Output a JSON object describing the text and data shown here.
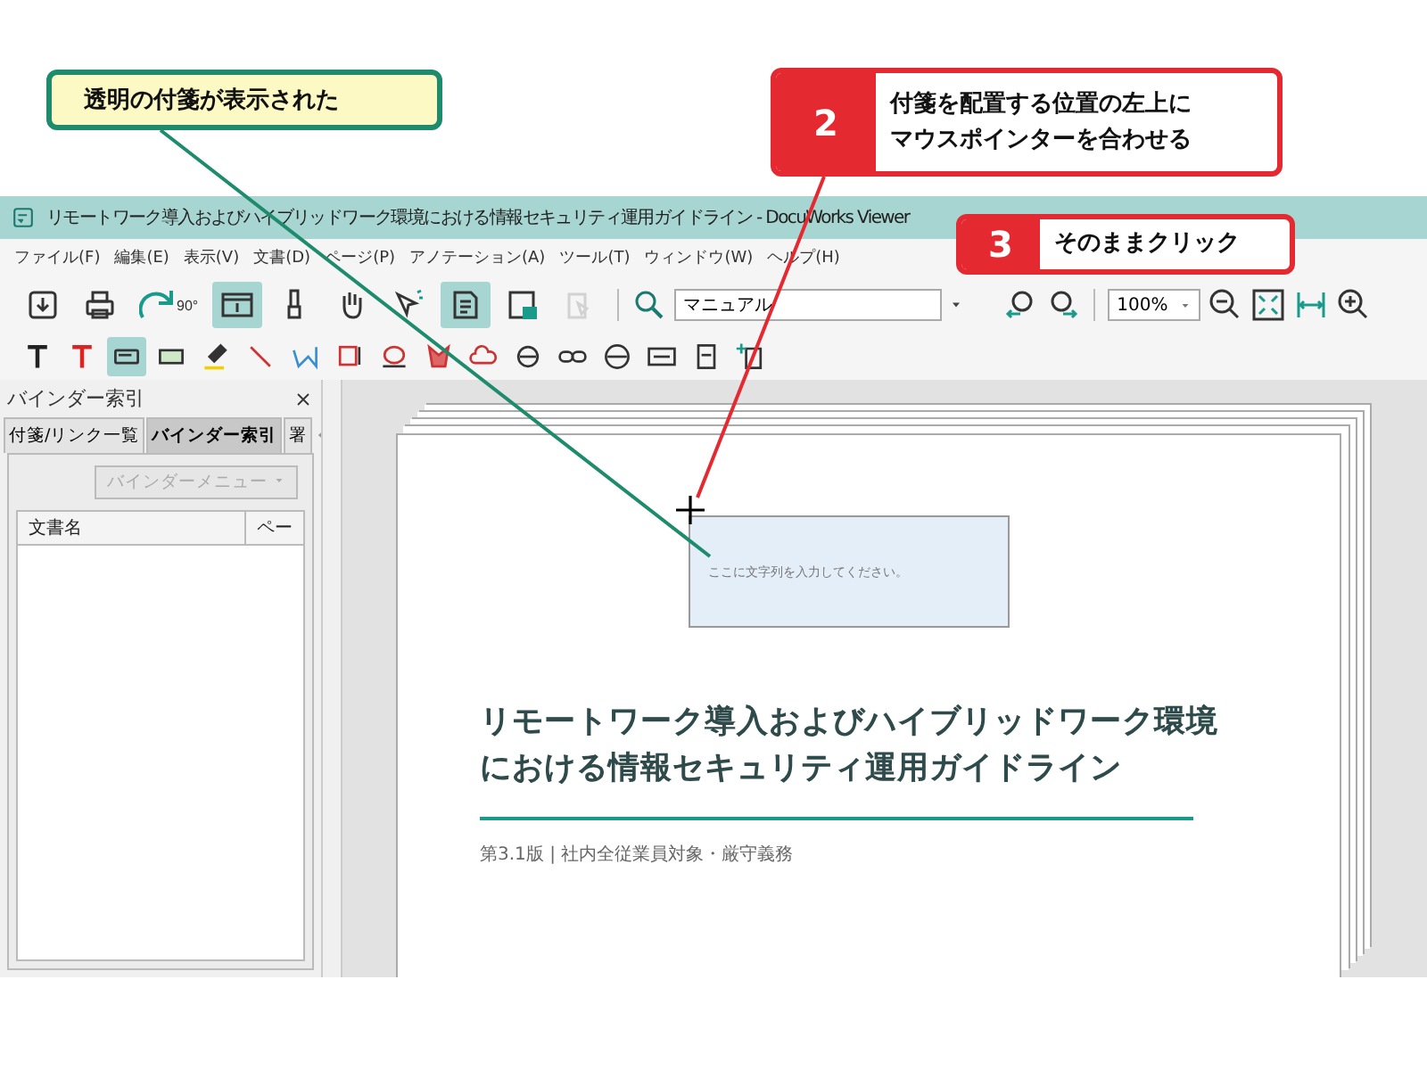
{
  "callouts": [
    {
      "kind": "note",
      "text": "透明の付箋が表示された"
    },
    {
      "kind": "step",
      "number": "2",
      "lines": [
        "付箋を配置する位置の左上に",
        "マウスポインターを合わせる"
      ]
    },
    {
      "kind": "step",
      "number": "3",
      "lines": [
        "そのままクリック"
      ]
    }
  ],
  "window": {
    "title": "リモートワーク導入およびハイブリッドワーク環境における情報セキュリティ運用ガイドライン - DocuWorks Viewer"
  },
  "menu": [
    "ファイル(F)",
    "編集(E)",
    "表示(V)",
    "文書(D)",
    "ページ(P)",
    "アノテーション(A)",
    "ツール(T)",
    "ウィンドウ(W)",
    "ヘルプ(H)"
  ],
  "toolbar": {
    "buttons": [
      {
        "selected": false
      },
      {
        "selected": false
      },
      {
        "selected": false,
        "label": "90°"
      },
      {
        "selected": true
      },
      {
        "selected": false
      },
      {
        "selected": false
      },
      {
        "selected": false
      },
      {
        "selected": true
      },
      {
        "selected": false
      },
      {
        "selected": false,
        "disabled": true
      }
    ],
    "search": {
      "value": "マニュアル"
    },
    "zoom": {
      "value": "100%"
    }
  },
  "annotation_toolbar": {
    "buttons": [
      {
        "selected": false
      },
      {
        "selected": false
      },
      {
        "selected": true
      },
      {
        "selected": false
      },
      {
        "selected": false
      },
      {
        "selected": false
      },
      {
        "selected": false
      },
      {
        "selected": false
      },
      {
        "selected": false
      },
      {
        "selected": false
      },
      {
        "selected": false
      },
      {
        "selected": false
      },
      {
        "selected": false
      },
      {
        "selected": false
      },
      {
        "selected": false
      },
      {
        "selected": false
      },
      {
        "selected": false
      }
    ]
  },
  "sidebar": {
    "title": "バインダー索引",
    "tabs": [
      {
        "label": "付箋/リンク一覧",
        "selected": false
      },
      {
        "label": "バインダー索引",
        "selected": true
      },
      {
        "label": "署",
        "selected": false
      }
    ],
    "menu_button": {
      "label": "バインダーメニュー",
      "disabled": true
    },
    "columns": [
      "文書名",
      "ペー"
    ]
  },
  "document": {
    "sticky_note": {
      "placeholder": "ここに文字列を入力してください。"
    },
    "title_lines": [
      "リモートワーク導入およびハイブリッドワーク環境",
      "における情報セキュリティ運用ガイドライン"
    ],
    "subtitle": "第3.1版 | 社内全従業員対象・厳守義務"
  }
}
